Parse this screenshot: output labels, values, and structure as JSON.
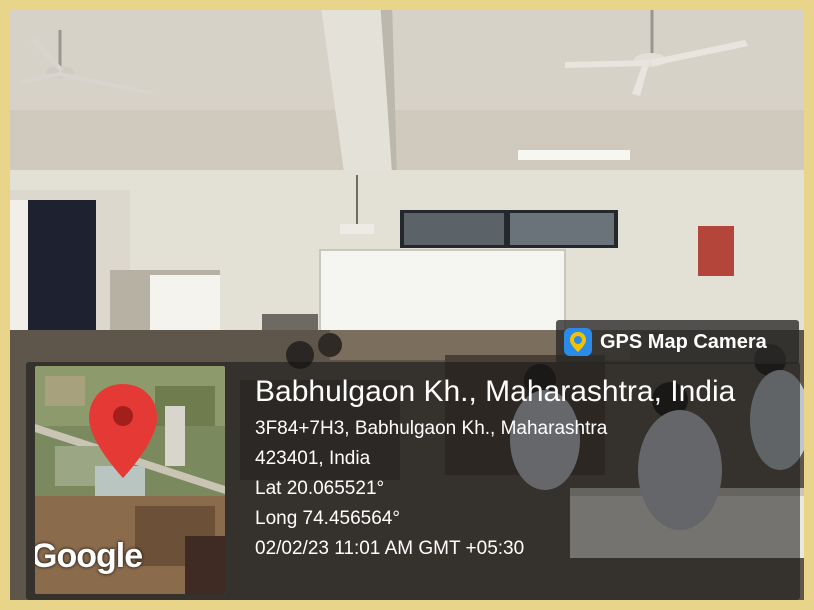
{
  "badge": {
    "app_name": "GPS Map Camera",
    "icon": "gps-map-camera-icon"
  },
  "map": {
    "provider_logo": "Google",
    "marker_icon": "map-pin-icon"
  },
  "location": {
    "place": "Babhulgaon Kh., Maharashtra, India",
    "address_line1": "3F84+7H3, Babhulgaon Kh., Maharashtra",
    "address_line2": "423401, India",
    "latitude": "Lat 20.065521°",
    "longitude": "Long 74.456564°",
    "timestamp": "02/02/23 11:01 AM GMT +05:30"
  },
  "colors": {
    "pin_red": "#e53935",
    "border_yellow": "#e9d58a",
    "badge_blue": "#2a8ce8"
  }
}
